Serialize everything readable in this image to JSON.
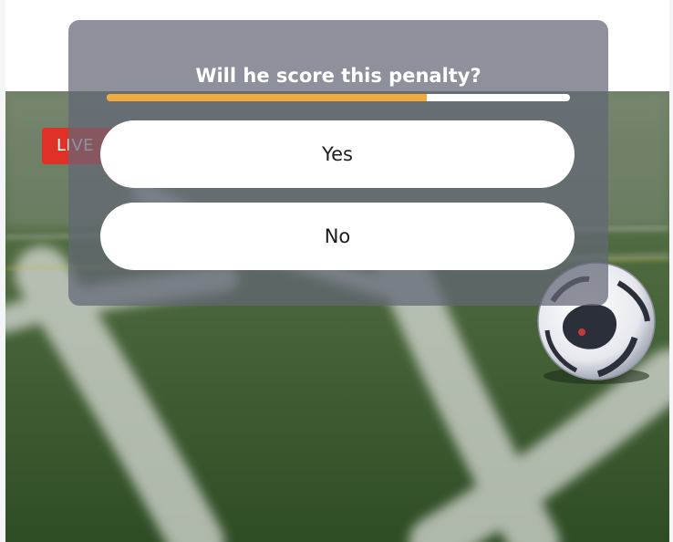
{
  "poll": {
    "question": "Will he score this penalty?",
    "timer_remaining_fraction": 0.69,
    "options": [
      {
        "label": "Yes"
      },
      {
        "label": "No"
      }
    ]
  },
  "stream": {
    "live_label": "LIVE",
    "live_color": "#e03127"
  },
  "colors": {
    "progress": "#f0ac3e",
    "poll_overlay": "#626676"
  }
}
